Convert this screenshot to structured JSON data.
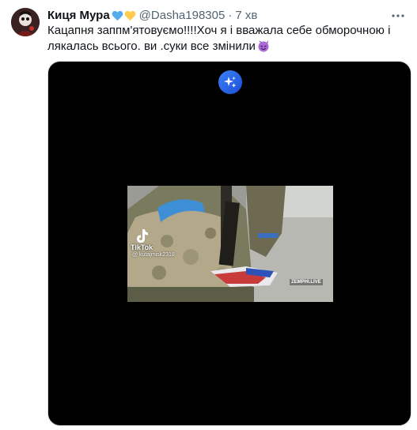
{
  "tweet": {
    "author_name": "Киця Мура",
    "handle": "@Dasha198305",
    "separator": "·",
    "time": "7 хв",
    "text": "Кацапня заппм'ятовуємо!!!!Хоч я і вважала себе обморочною і лякалась всього. ви .суки все змінили",
    "more_icon": "more-horizontal-icon",
    "emoji": "smiling-imp-emoji",
    "heart_colors": [
      "#55acee",
      "#ffcc4d"
    ]
  },
  "media": {
    "type": "video",
    "enhance_icon": "sparkles-icon",
    "watermark_brand": "TikTok",
    "watermark_user": "@ kutajmisk2318",
    "overlay_badge": "ZEMPHI.LIVE"
  }
}
